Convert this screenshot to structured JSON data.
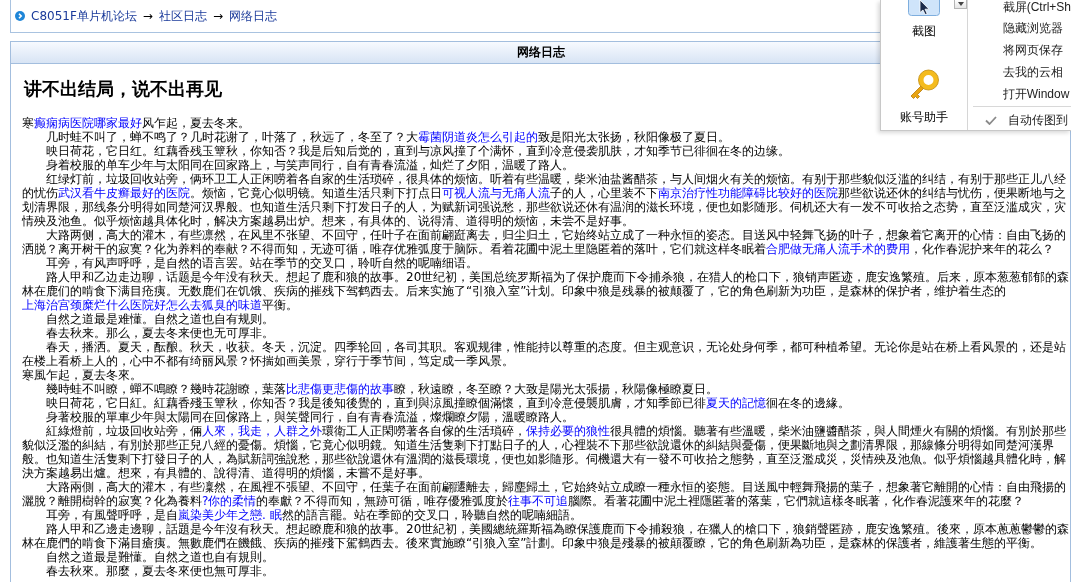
{
  "breadcrumb": [
    {
      "kind": "link",
      "text": "C8051F单片机论坛"
    },
    {
      "kind": "separator",
      "text": "→"
    },
    {
      "kind": "link",
      "text": "社区日志"
    },
    {
      "kind": "separator",
      "text": "→"
    },
    {
      "kind": "link",
      "text": "网络日志"
    }
  ],
  "panel": {
    "header": "网络日志",
    "title": "讲不出结局，说不出再见",
    "paragraphs": [
      {
        "indented": false,
        "parts": [
          {
            "kind": "text",
            "text": "寒"
          },
          {
            "kind": "link",
            "text": "癫痫病医院哪家最好"
          },
          {
            "kind": "text",
            "text": "风乍起，夏去冬来。"
          }
        ]
      },
      {
        "indented": true,
        "parts": [
          {
            "kind": "text",
            "text": "几时蛙不叫了，蝉不鸣了？几时花谢了，叶落了，秋远了，冬至了？大"
          },
          {
            "kind": "link",
            "text": "霉菌阴道炎怎么引起的"
          },
          {
            "kind": "text",
            "text": "致是阳光太张扬，秋阳像极了夏日。"
          }
        ]
      },
      {
        "indented": true,
        "parts": [
          {
            "kind": "text",
            "text": "映日荷花，它日红。红藕香残玉簟秋，你知否？我是后知后觉的，直到与凉风撞了个满怀，直到冷意侵袭肌肤，才知季节已徘徊在冬的边缘。"
          }
        ]
      },
      {
        "indented": true,
        "parts": [
          {
            "kind": "text",
            "text": "身着校服的单车少年与太阳同在回家路上，与笑声同行，自有青春流溢，灿烂了夕阳，温暖了路人。"
          }
        ]
      },
      {
        "indented": true,
        "parts": [
          {
            "kind": "text",
            "text": "红绿灯前，垃圾回收站旁，俩环卫工人正闲唠着各自家的生活琐碎，很具体的烦恼。听着有些温暖，柴米油盐酱醋茶，与人间烟火有关的烦恼。有别于那些貌似泛滥的纠结，有别于那些正儿八经的忧伤"
          },
          {
            "kind": "link",
            "text": "武汉看牛皮癣最好的医院"
          },
          {
            "kind": "text",
            "text": "。烦恼，它竟心似明镜。知道生活只剩下打点日"
          },
          {
            "kind": "link",
            "text": "可视人流与无痛人流"
          },
          {
            "kind": "text",
            "text": "子的人，心里装不下"
          },
          {
            "kind": "link",
            "text": "南京治疗性功能障碍比较好的医院"
          },
          {
            "kind": "text",
            "text": "那些欲说还休的纠结与忧伤，便果断地与之划清界限，那线条分明得如同楚河汉界般。也知道生活只剩下打发日子的人，为赋新词强说愁，那些欲说还休有温润的滋长环境，便也如影随形。伺机还大有一发不可收拾之态势，直至泛滥成灾，灾情殃及池鱼。似乎烦恼越具体化时，解决方案越易出炉。想来，有具体的、说得清、道得明的烦恼，未尝不是好事。"
          }
        ]
      },
      {
        "indented": true,
        "parts": [
          {
            "kind": "text",
            "text": "大路两侧，高大的灌木，有些凛然，在风里不张望、不回守，任叶子在面前翩跹离去，归尘归土，它始终站立成了一种永恒的姿态。目送风中轻舞飞扬的叶子，想象着它离开的心情：自由飞扬的洒脱？离开树干的寂寞？化为养料的奉献？不得而知，无迹可循，唯存优雅弧度于脑际。看着花圃中泥土里隐匿着的落叶，它们就这样冬眠着"
          },
          {
            "kind": "link",
            "text": "合肥做无痛人流手术的费用"
          },
          {
            "kind": "text",
            "text": "，化作春泥护来年的花么？"
          }
        ]
      },
      {
        "indented": true,
        "parts": [
          {
            "kind": "text",
            "text": "耳旁，有风声呼呼，是自然的语言罢。站在季节的交叉口，聆听自然的呢喃细语。"
          }
        ]
      },
      {
        "indented": true,
        "parts": [
          {
            "kind": "text",
            "text": "路人甲和乙边走边聊，话题是今年没有秋天。想起了鹿和狼的故事。20世纪初，美国总统罗斯福为了保护鹿而下令捕杀狼，在猎人的枪口下，狼销声匿迹，鹿安逸繁殖。后来，原本葱葱郁郁的森林在鹿们的啃食下满目疮痍。无数鹿们在饥饿、疾病的摧残下驾鹤西去。后来实施了“引狼入室”计划。印象中狼是残暴的被颠覆了，它的角色刷新为功臣，是森林的保护者，维护着生态的"
          },
          {
            "kind": "link",
            "text": "上海治宫颈糜烂什么医院好怎么去狐臭的味道"
          },
          {
            "kind": "text",
            "text": "平衡。"
          }
        ]
      },
      {
        "indented": true,
        "parts": [
          {
            "kind": "text",
            "text": "自然之道最是难懂。自然之道也自有规则。"
          }
        ]
      },
      {
        "indented": true,
        "parts": [
          {
            "kind": "text",
            "text": "春去秋来。那么，夏去冬来便也无可厚非。"
          }
        ]
      },
      {
        "indented": true,
        "parts": [
          {
            "kind": "text",
            "text": "春天，播洒。夏天，酝酿。秋天，收获。冬天，沉淀。四季轮回，各司其职。客观规律，惟能持以尊重的态度。但主观意识，无论处身何季，都可种植希望。无论你是站在桥上看风景的，还是站在楼上看桥上人的，心中不都有绮丽风景？怀揣如画美景，穿行于季节间，笃定成一季风景。"
          }
        ]
      },
      {
        "indented": false,
        "parts": [
          {
            "kind": "text",
            "text": "寒風乍起，夏去冬來。"
          }
        ]
      },
      {
        "indented": true,
        "parts": [
          {
            "kind": "text",
            "text": "幾時蛙不叫瞭，蟬不鳴瞭？幾時花謝瞭，葉落"
          },
          {
            "kind": "link",
            "text": "比悲傷更悲傷的故事"
          },
          {
            "kind": "text",
            "text": "瞭，秋遠瞭，冬至瞭？大致是陽光太張揚，秋陽像極瞭夏日。"
          }
        ]
      },
      {
        "indented": true,
        "parts": [
          {
            "kind": "text",
            "text": "映日荷花，它日紅。紅藕香殘玉簟秋，你知否？我是後知後覺的，直到與涼風撞瞭個滿懷，直到冷意侵襲肌膚，才知季節已徘"
          },
          {
            "kind": "link",
            "text": "夏天的記憶"
          },
          {
            "kind": "text",
            "text": "徊在冬的邊緣。"
          }
        ]
      },
      {
        "indented": true,
        "parts": [
          {
            "kind": "text",
            "text": "身著校服的單車少年與太陽同在回傢路上，與笑聲同行，自有青春流溢，燦爛瞭夕陽，溫暖瞭路人。"
          }
        ]
      },
      {
        "indented": true,
        "parts": [
          {
            "kind": "text",
            "text": "紅綠燈前，垃圾回收站旁，倆"
          },
          {
            "kind": "link",
            "text": "人來，我走，人群之外"
          },
          {
            "kind": "text",
            "text": "環衛工人正閑嘮著各自傢的生活瑣碎，"
          },
          {
            "kind": "link",
            "text": "保持必要的狼性"
          },
          {
            "kind": "text",
            "text": "很具體的煩惱。聽著有些溫暖，柴米油鹽醬醋茶，與人間煙火有關的煩惱。有別於那些貌似泛濫的糾結，有別於那些正兒八經的憂傷。煩惱，它竟心似明鏡。知道生活隻剩下打點日子的人，心裡裝不下那些欲說還休的糾結與憂傷，便果斷地與之劃清界限，那線條分明得如同楚河漢界般。也知道生活隻剩下打發日子的人，為賦新詞強說愁，那些欲說還休有溫潤的滋長環境，便也如影隨形。伺機還大有一發不可收拾之態勢，直至泛濫成災，災情殃及池魚。似乎煩惱越具體化時，解決方案越易出爐。想來，有具體的、說得清、道得明的煩惱，未嘗不是好事。"
          }
        ]
      },
      {
        "indented": true,
        "parts": [
          {
            "kind": "text",
            "text": "大路兩側，高大的灌木，有些凜然，在風裡不張望、不回守，任葉子在面前翩躚離去，歸塵歸土，它始終站立成瞭一種永恒的姿態。目送風中輕舞飛揚的葉子，想象著它離開的心情：自由飛揚的灑脫？離開樹幹的寂寞？化為養料"
          },
          {
            "kind": "link",
            "text": "?你的柔情"
          },
          {
            "kind": "text",
            "text": "的奉獻？不得而知，無跡可循，唯存優雅弧度於"
          },
          {
            "kind": "link",
            "text": "往事不可追"
          },
          {
            "kind": "text",
            "text": "腦際。看著花圃中泥土裡隱匿著的落葉，它們就這樣冬眠著，化作春泥護來年的花麼？"
          }
        ]
      },
      {
        "indented": true,
        "parts": [
          {
            "kind": "text",
            "text": "耳旁，有風聲呼呼，是自"
          },
          {
            "kind": "link",
            "text": "嵐染美少年之戀. 眠"
          },
          {
            "kind": "text",
            "text": "然的語言罷。站在季節的交叉口，聆聽自然的呢喃細語。"
          }
        ]
      },
      {
        "indented": true,
        "parts": [
          {
            "kind": "text",
            "text": "路人甲和乙邊走邊聊，話題是今年沒有秋天。想起瞭鹿和狼的故事。20世紀初，美國總統羅斯福為瞭保護鹿而下令捕殺狼，在獵人的槍口下，狼銷聲匿跡，鹿安逸繁殖。後來，原本蔥蔥鬱鬱的森林在鹿們的啃食下滿目瘡痍。無數鹿們在饑餓、疾病的摧殘下駕鶴西去。後來實施瞭“引狼入室”計劃。印象中狼是殘暴的被顛覆瞭，它的角色刷新為功臣，是森林的保護者，維護著生態的平衡。"
          }
        ]
      },
      {
        "indented": true,
        "parts": [
          {
            "kind": "text",
            "text": "自然之道最是難懂。自然之道也自有規則。"
          }
        ]
      },
      {
        "indented": true,
        "parts": [
          {
            "kind": "text",
            "text": "春去秋來。那麼，夏去冬來便也無可厚非。"
          }
        ]
      }
    ]
  },
  "popup": {
    "tools": [
      {
        "kind": "screenshot",
        "label": "截图",
        "selected": true
      },
      {
        "kind": "account",
        "label": "账号助手",
        "selected": false
      }
    ],
    "menu_sections": [
      [
        {
          "label": "截屏(Ctrl+Sh",
          "checked": false
        },
        {
          "label": "隐藏浏览器",
          "checked": false
        },
        {
          "label": "将网页保存",
          "checked": false
        },
        {
          "label": "去我的云相",
          "checked": false
        },
        {
          "label": "打开Window",
          "checked": false
        }
      ],
      [
        {
          "label": "自动传图到",
          "checked": true
        }
      ]
    ]
  }
}
